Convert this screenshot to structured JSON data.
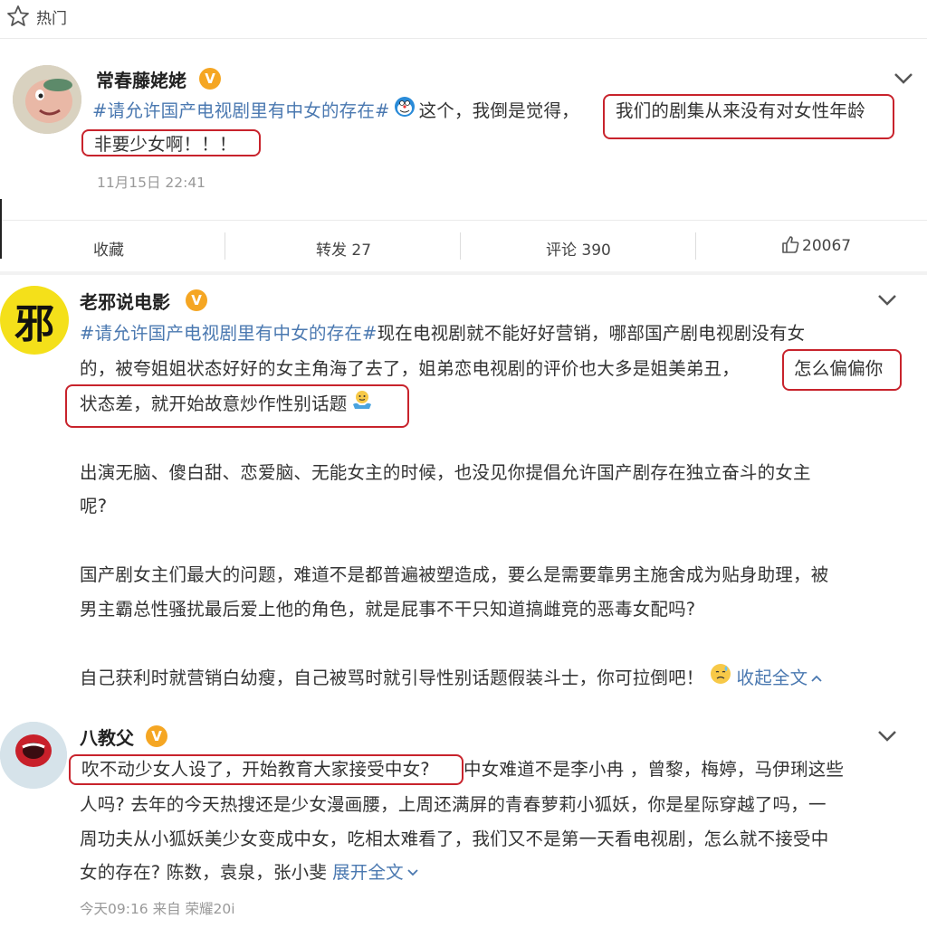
{
  "header": {
    "label": "热门",
    "icon": "star-outline-icon"
  },
  "posts": [
    {
      "username": "常春藤姥姥",
      "verified": "V",
      "line1_tag": "#请允许国产电视剧里有中女的存在#",
      "line1_text": "这个，我倒是觉得，",
      "line1_boxed": "我们的剧集从来没有对女性年龄",
      "line2_boxed": "非要少女啊！！！",
      "timestamp": "11月15日 22:41",
      "actions": {
        "collect": "收藏",
        "repost": "转发 27",
        "comment": "评论 390",
        "like": "20067"
      }
    },
    {
      "username": "老邪说电影",
      "avatar_text": "邪",
      "verified": "V",
      "line1_tag": "#请允许国产电视剧里有中女的存在#",
      "line1_text": "现在电视剧就不能好好营销，哪部国产剧电视剧没有女",
      "line2_text": "的，被夸姐姐状态好好的女主角海了去了，姐弟恋电视剧的评价也大多是姐美弟丑，",
      "line2_boxed": "怎么偏偏你",
      "line3_boxed": "状态差，就开始故意炒作性别话题",
      "para2_line1": "出演无脑、傻白甜、恋爱脑、无能女主的时候，也没见你提倡允许国产剧存在独立奋斗的女主",
      "para2_line2": "呢?",
      "para3_line1": "国产剧女主们最大的问题，难道不是都普遍被塑造成，要么是需要靠男主施舍成为贴身助理，被",
      "para3_line2": "男主霸总性骚扰最后爱上他的角色，就是屁事不干只知道搞雌竞的恶毒女配吗?",
      "para4_text": "自己获利时就营销白幼瘦，自己被骂时就引导性别话题假装斗士，你可拉倒吧！",
      "collapse_label": "收起全文"
    },
    {
      "username": "八教父",
      "verified": "V",
      "line1_boxed": "吹不动少女人设了，开始教育大家接受中女?",
      "line1_text": "中女难道不是李小冉 ，曾黎，梅婷，马伊琍这些",
      "line2_text": "人吗? 去年的今天热搜还是少女漫画腰，上周还满屏的青春萝莉小狐妖，你是星际穿越了吗，一",
      "line3_text": "周功夫从小狐妖美少女变成中女，吃相太难看了，我们又不是第一天看电视剧，怎么就不接受中",
      "line4_text": "女的存在? 陈数，袁泉，张小斐",
      "expand_label": "展开全文",
      "meta": "今天09:16  来自 荣耀20i"
    }
  ],
  "colors": {
    "topic_link": "#4a78b0",
    "highlight_box": "#c8232c",
    "verified_badge": "#f5a623"
  }
}
